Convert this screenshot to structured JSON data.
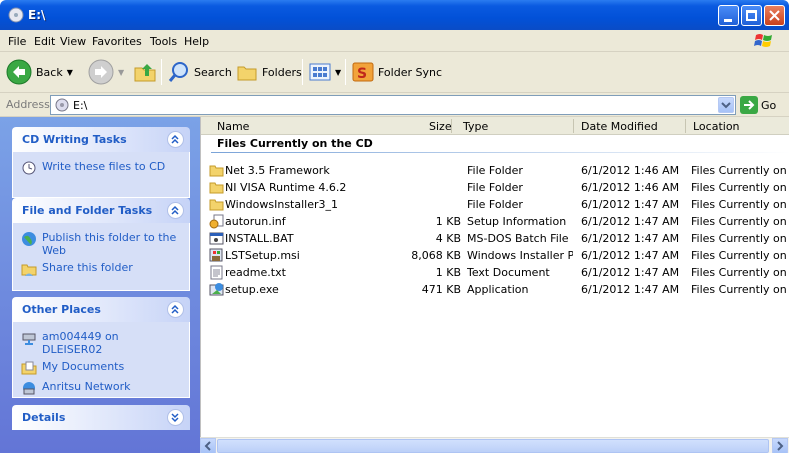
{
  "window": {
    "title": "E:\\"
  },
  "menu": [
    "File",
    "Edit",
    "View",
    "Favorites",
    "Tools",
    "Help"
  ],
  "toolbar": {
    "back_label": "Back",
    "search_label": "Search",
    "folders_label": "Folders",
    "folder_sync_label": "Folder Sync"
  },
  "address": {
    "label": "Address",
    "value": "E:\\",
    "go_label": "Go"
  },
  "tasks": {
    "cd_writing": {
      "title": "CD Writing Tasks",
      "items": [
        "Write these files to CD"
      ]
    },
    "file_folder": {
      "title": "File and Folder Tasks",
      "items": [
        "Publish this folder to the Web",
        "Share this folder"
      ]
    },
    "other_places": {
      "title": "Other Places",
      "items": [
        "am004449 on DLEISER02",
        "My Documents",
        "Anritsu Network"
      ]
    },
    "details": {
      "title": "Details"
    }
  },
  "filelist": {
    "columns": [
      "Name",
      "Size",
      "Type",
      "Date Modified",
      "Location"
    ],
    "group_name": "Files Currently on the CD",
    "rows": [
      {
        "name": "Net 3.5 Framework",
        "size": "",
        "type": "File Folder",
        "date": "6/1/2012 1:46 AM",
        "location": "Files Currently on t...",
        "icon": "folder-icon"
      },
      {
        "name": "NI VISA Runtime 4.6.2",
        "size": "",
        "type": "File Folder",
        "date": "6/1/2012 1:46 AM",
        "location": "Files Currently on t...",
        "icon": "folder-icon"
      },
      {
        "name": "WindowsInstaller3_1",
        "size": "",
        "type": "File Folder",
        "date": "6/1/2012 1:47 AM",
        "location": "Files Currently on t...",
        "icon": "folder-icon"
      },
      {
        "name": "autorun.inf",
        "size": "1 KB",
        "type": "Setup Information",
        "date": "6/1/2012 1:47 AM",
        "location": "Files Currently on t...",
        "icon": "setup-info-icon"
      },
      {
        "name": "INSTALL.BAT",
        "size": "4 KB",
        "type": "MS-DOS Batch File",
        "date": "6/1/2012 1:47 AM",
        "location": "Files Currently on t...",
        "icon": "batch-file-icon"
      },
      {
        "name": "LSTSetup.msi",
        "size": "8,068 KB",
        "type": "Windows Installer P...",
        "date": "6/1/2012 1:47 AM",
        "location": "Files Currently on t...",
        "icon": "msi-icon"
      },
      {
        "name": "readme.txt",
        "size": "1 KB",
        "type": "Text Document",
        "date": "6/1/2012 1:47 AM",
        "location": "Files Currently on t...",
        "icon": "text-file-icon"
      },
      {
        "name": "setup.exe",
        "size": "471 KB",
        "type": "Application",
        "date": "6/1/2012 1:47 AM",
        "location": "Files Currently on t...",
        "icon": "application-icon"
      }
    ]
  }
}
